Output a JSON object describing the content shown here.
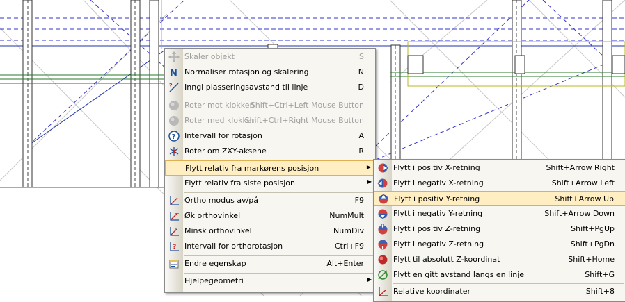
{
  "main_menu": {
    "items": [
      {
        "icon": "move-arrows-icon",
        "label": "Skaler objekt",
        "shortcut": "S",
        "disabled": true
      },
      {
        "icon": "normalize-n-icon",
        "label": "Normaliser rotasjon og skalering",
        "shortcut": "N"
      },
      {
        "icon": "distance-line-icon",
        "label": "Inngi plasseringsavstand til linje",
        "shortcut": "D"
      },
      {
        "icon": "rotate-ccw-icon",
        "label": "Roter mot klokken",
        "shortcut": "Shift+Ctrl+Left Mouse Button",
        "disabled": true
      },
      {
        "icon": "rotate-cw-icon",
        "label": "Roter med klokken",
        "shortcut": "Shift+Ctrl+Right Mouse Button",
        "disabled": true
      },
      {
        "icon": "rotation-interval-icon",
        "label": "Intervall for rotasjon",
        "shortcut": "A"
      },
      {
        "icon": "rotate-zxy-icon",
        "label": "Roter om ZXY-aksene",
        "shortcut": "R"
      },
      {
        "label": "Flytt relativ fra markørens posisjon",
        "submenu": true,
        "highlighted": true
      },
      {
        "label": "Flytt relativ fra siste posisjon",
        "submenu": true
      },
      {
        "icon": "ortho-mode-icon",
        "label": "Ortho modus av/på",
        "shortcut": "F9"
      },
      {
        "icon": "increase-ortho-angle-icon",
        "label": "Øk orthovinkel",
        "shortcut": "NumMult"
      },
      {
        "icon": "decrease-ortho-angle-icon",
        "label": "Minsk orthovinkel",
        "shortcut": "NumDiv"
      },
      {
        "icon": "ortho-rotation-interval-icon",
        "label": "Intervall for orthorotasjon",
        "shortcut": "Ctrl+F9"
      },
      {
        "icon": "edit-properties-icon",
        "label": "Endre egenskap",
        "shortcut": "Alt+Enter"
      },
      {
        "label": "Hjelpegeometri",
        "submenu": true
      }
    ]
  },
  "sub_menu": {
    "items": [
      {
        "icon": "move-x-positive-icon",
        "label": "Flytt i positiv X-retning",
        "shortcut": "Shift+Arrow Right"
      },
      {
        "icon": "move-x-negative-icon",
        "label": "Flytt i negativ X-retning",
        "shortcut": "Shift+Arrow Left"
      },
      {
        "icon": "move-y-positive-icon",
        "label": "Flytt i positiv Y-retning",
        "shortcut": "Shift+Arrow Up",
        "highlighted": true
      },
      {
        "icon": "move-y-negative-icon",
        "label": "Flytt i negativ Y-retning",
        "shortcut": "Shift+Arrow Down"
      },
      {
        "icon": "move-z-positive-icon",
        "label": "Flytt i positiv Z-retning",
        "shortcut": "Shift+PgUp"
      },
      {
        "icon": "move-z-negative-icon",
        "label": "Flytt i negativ Z-retning",
        "shortcut": "Shift+PgDn"
      },
      {
        "icon": "absolute-z-icon",
        "label": "Flytt til absolutt Z-koordinat",
        "shortcut": "Shift+Home"
      },
      {
        "icon": "distance-along-line-icon",
        "label": "Flytt en gitt avstand langs en linje",
        "shortcut": "Shift+G"
      },
      {
        "icon": "relative-coordinates-icon",
        "label": "Relative koordinater",
        "shortcut": "Shift+8"
      }
    ]
  }
}
